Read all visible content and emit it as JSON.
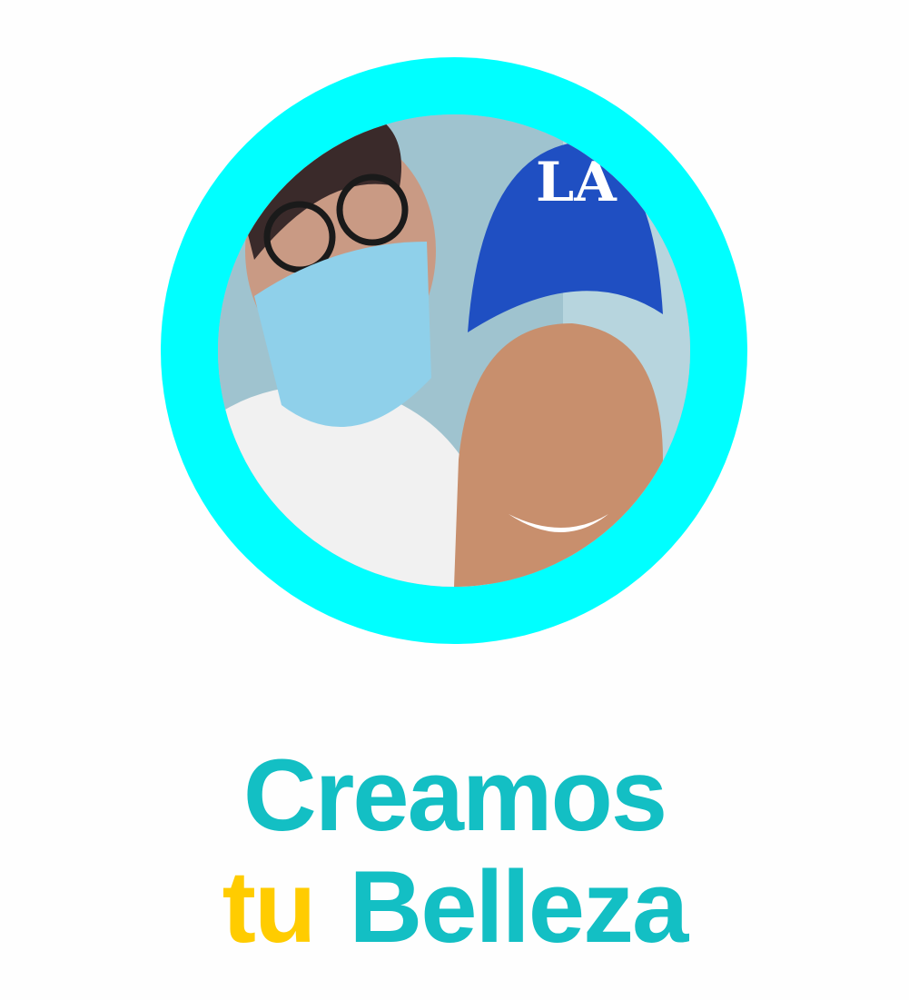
{
  "photo": {
    "alt": "profile photo of two people smiling"
  },
  "headline": {
    "line1": "Creamos",
    "accent": "tu",
    "line2": "Belleza"
  },
  "colors": {
    "ring": "#00ffff",
    "primary_text": "#13bfc4",
    "accent_text": "#ffcc00"
  }
}
